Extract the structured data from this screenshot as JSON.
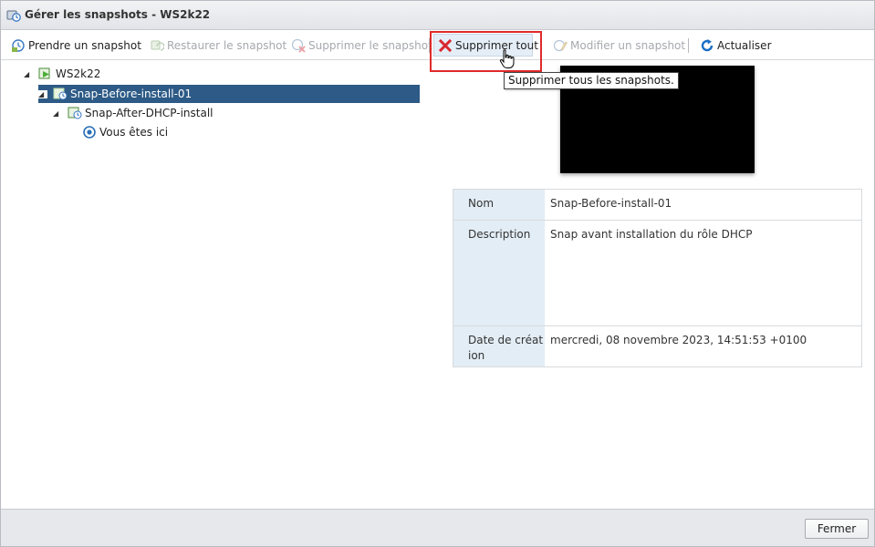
{
  "window": {
    "title": "Gérer les snapshots - WS2k22"
  },
  "toolbar": {
    "take_snapshot": "Prendre un snapshot",
    "restore_snapshot": "Restaurer le snapshot",
    "delete_snapshot": "Supprimer le snapshot",
    "delete_all": "Supprimer tout",
    "edit_snapshot": "Modifier un snapshot",
    "refresh": "Actualiser"
  },
  "tooltip": {
    "text": "Supprimer tous les snapshots."
  },
  "tree": {
    "root": "WS2k22",
    "items": [
      {
        "label": "Snap-Before-install-01",
        "selected": true
      },
      {
        "label": "Snap-After-DHCP-install",
        "selected": false
      },
      {
        "label": "Vous êtes ici",
        "selected": false
      }
    ]
  },
  "details": {
    "name_label": "Nom",
    "name_value": "Snap-Before-install-01",
    "description_label": "Description",
    "description_value": "Snap avant installation du rôle DHCP",
    "date_label_line1": "Date de créat",
    "date_label_line2": "ion",
    "date_value": "mercredi, 08 novembre 2023, 14:51:53 +0100"
  },
  "footer": {
    "close_label": "Fermer"
  },
  "colors": {
    "accent_selected": "#2d5a86",
    "highlight_box": "#e02a2a",
    "label_cell_bg": "#e3edf5",
    "refresh_blue": "#1a6fc4",
    "delete_red": "#d9282f"
  }
}
